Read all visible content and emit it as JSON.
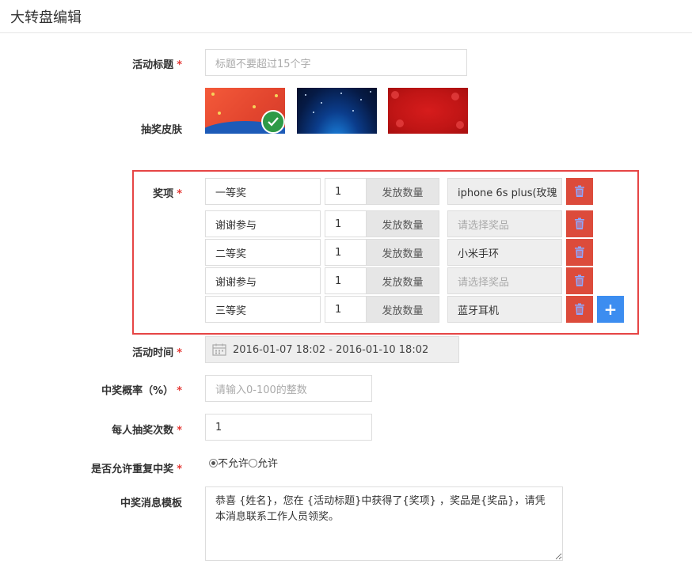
{
  "page": {
    "title": "大转盘编辑"
  },
  "form": {
    "title": {
      "label": "活动标题",
      "placeholder": "标题不要超过15个字",
      "value": ""
    },
    "skin": {
      "label": "抽奖皮肤",
      "selected_index": 0
    },
    "prizes": {
      "label": "奖项",
      "quantity_label": "发放数量",
      "rows": [
        {
          "name": "一等奖",
          "qty": "1",
          "prize": "iphone 6s plus(玫瑰",
          "prize_placeholder": false
        },
        {
          "name": "谢谢参与",
          "qty": "1",
          "prize": "请选择奖品",
          "prize_placeholder": true
        },
        {
          "name": "二等奖",
          "qty": "1",
          "prize": "小米手环",
          "prize_placeholder": false
        },
        {
          "name": "谢谢参与",
          "qty": "1",
          "prize": "请选择奖品",
          "prize_placeholder": true
        },
        {
          "name": "三等奖",
          "qty": "1",
          "prize": "蓝牙耳机",
          "prize_placeholder": false
        }
      ],
      "add_label": "+"
    },
    "time": {
      "label": "活动时间",
      "value": "2016-01-07 18:02 - 2016-01-10 18:02"
    },
    "probability": {
      "label": "中奖概率（%）",
      "placeholder": "请输入0-100的整数"
    },
    "times_per_person": {
      "label": "每人抽奖次数",
      "value": "1"
    },
    "repeat": {
      "label": "是否允许重复中奖",
      "options": [
        "不允许",
        "允许"
      ],
      "selected": "不允许"
    },
    "template": {
      "label": "中奖消息模板",
      "value": "恭喜 {姓名}，您在 {活动标题}中获得了{奖项} ，奖品是{奖品}，请凭本消息联系工作人员领奖。"
    }
  },
  "colors": {
    "required": "#e53935",
    "delete": "#dc4b3b",
    "add": "#3c8df0",
    "highlight_border": "#e64545",
    "check": "#2e9a47"
  }
}
